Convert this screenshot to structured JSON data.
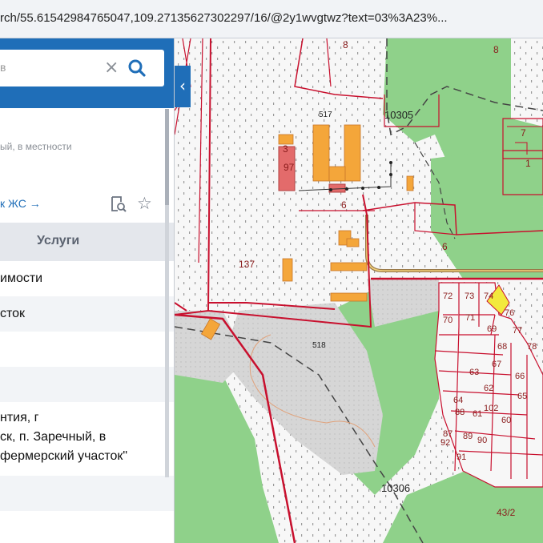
{
  "browser": {
    "url": "rch/55.61542984765047,109.27135627302297/16/@2y1wvgtwz?text=03%3A23%..."
  },
  "panel": {
    "search": {
      "value": "",
      "placeholder": "в"
    },
    "address_fragment": "ый, в местности",
    "link_text": "к ЖС →",
    "tabs": {
      "services": "Услуги"
    },
    "rows": [
      "имости",
      "сток",
      "",
      "",
      "",
      "",
      "",
      ""
    ],
    "note": [
      "нтия, г",
      "ск, п. Заречный, в",
      "фермерский участок\""
    ]
  },
  "map": {
    "colors": {
      "forest": "#8fd18a",
      "open": "#f4f4f4",
      "parcel_border": "#c8102e",
      "building": "#f4a63a",
      "road": "#9a7a4a"
    },
    "labels": {
      "quarter_north": "10305",
      "quarter_south": "10306",
      "parcel_517": "517",
      "parcel_518": "518",
      "parcel_137": "137",
      "parcel_8a": "8",
      "parcel_8b": "8",
      "parcel_7": "7",
      "parcel_1": "1",
      "parcel_6a": "6",
      "parcel_6b": "6",
      "parcel_3": "3",
      "parcel_97": "97",
      "parcel_43_2": "43/2",
      "plots": [
        "72",
        "73",
        "74",
        "70",
        "71",
        "69",
        "76",
        "68",
        "77",
        "78",
        "63",
        "67",
        "66",
        "64",
        "62",
        "102",
        "65",
        "87",
        "88",
        "61",
        "60",
        "92",
        "89",
        "90",
        "91"
      ]
    }
  }
}
